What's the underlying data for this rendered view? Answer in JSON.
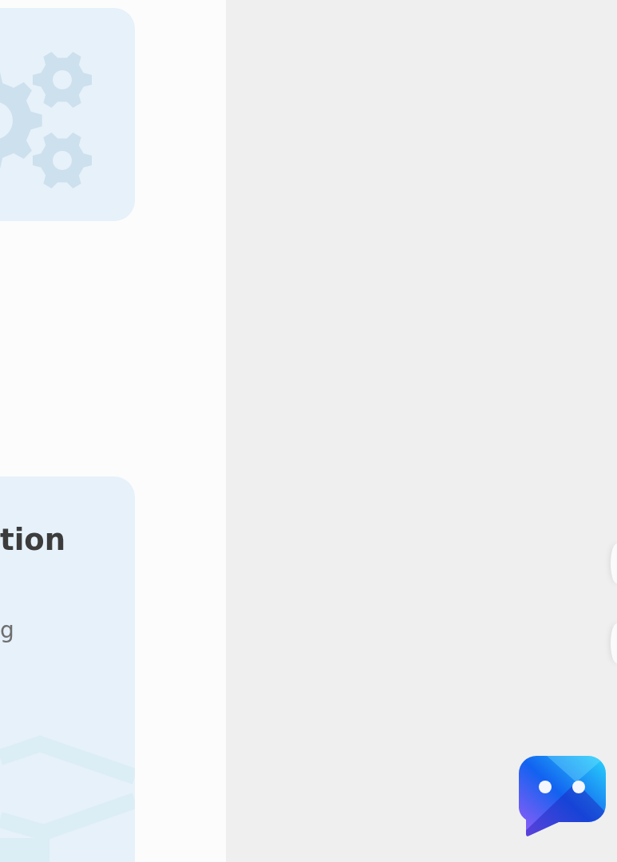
{
  "cards": [
    {
      "kind": "illustration"
    },
    {
      "kind": "article",
      "title": "tion",
      "text": "g"
    }
  ]
}
